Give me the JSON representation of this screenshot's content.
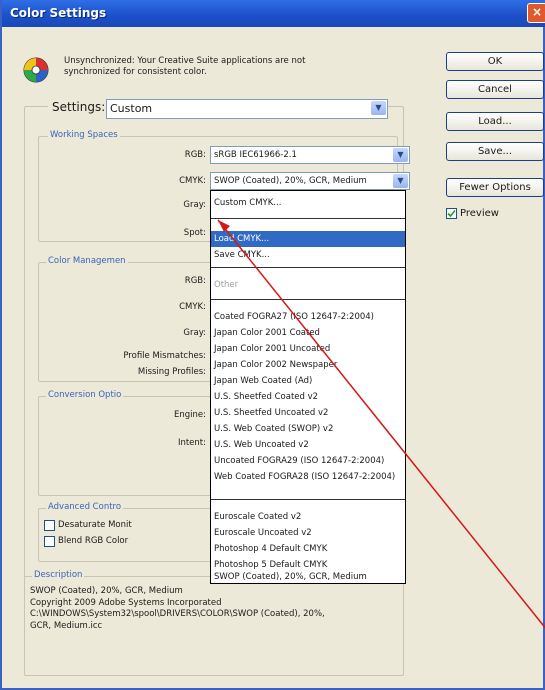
{
  "window": {
    "title": "Color Settings",
    "close_glyph": "×"
  },
  "message": "Unsynchronized: Your Creative Suite applications are not synchronized for consistent color.",
  "settings": {
    "label": "Settings:",
    "value": "Custom"
  },
  "buttons": {
    "ok": "OK",
    "cancel": "Cancel",
    "load": "Load...",
    "save": "Save...",
    "fewer": "Fewer Options"
  },
  "preview": {
    "label": "Preview",
    "checked": true
  },
  "working_spaces": {
    "title": "Working Spaces",
    "rgb_label": "RGB:",
    "rgb_value": "sRGB IEC61966-2.1",
    "cmyk_label": "CMYK:",
    "cmyk_value": "SWOP (Coated), 20%, GCR, Medium",
    "gray_label": "Gray:",
    "spot_label": "Spot:"
  },
  "color_management": {
    "title": "Color Managemen",
    "rgb_label": "RGB:",
    "cmyk_label": "CMYK:",
    "gray_label": "Gray:",
    "mismatch_label": "Profile Mismatches:",
    "missing_label": "Missing Profiles:"
  },
  "conversion": {
    "title": "Conversion Optio",
    "engine_label": "Engine:",
    "intent_label": "Intent:"
  },
  "advanced": {
    "title": "Advanced Contro",
    "desaturate": "Desaturate Monit",
    "blend": "Blend RGB Color"
  },
  "description": {
    "title": "Description",
    "lines": [
      "SWOP (Coated), 20%, GCR, Medium",
      "Copyright 2009 Adobe Systems Incorporated",
      "C:\\WINDOWS\\System32\\spool\\DRIVERS\\COLOR\\SWOP (Coated), 20%,",
      "GCR, Medium.icc"
    ]
  },
  "cmyk_menu": {
    "top": [
      "Custom CMYK..."
    ],
    "load": "Load CMYK...",
    "save": "Save CMYK...",
    "other": "Other",
    "list1": [
      "Coated FOGRA27 (ISO 12647-2:2004)",
      "Japan Color 2001 Coated",
      "Japan Color 2001 Uncoated",
      "Japan Color 2002 Newspaper",
      "Japan Web Coated (Ad)",
      "U.S. Sheetfed Coated v2",
      "U.S. Sheetfed Uncoated v2",
      "U.S. Web Coated (SWOP) v2",
      "U.S. Web Uncoated v2",
      "Uncoated FOGRA29 (ISO 12647-2:2004)",
      "Web Coated FOGRA28 (ISO 12647-2:2004)"
    ],
    "list2": [
      "Euroscale Coated v2",
      "Euroscale Uncoated v2",
      "Photoshop 4 Default CMYK",
      "Photoshop 5 Default CMYK",
      "SWOP (Coated), 20%, GCR, Medium"
    ]
  },
  "colors": {
    "selection": "#316ac5",
    "annotation": "#d41818"
  }
}
